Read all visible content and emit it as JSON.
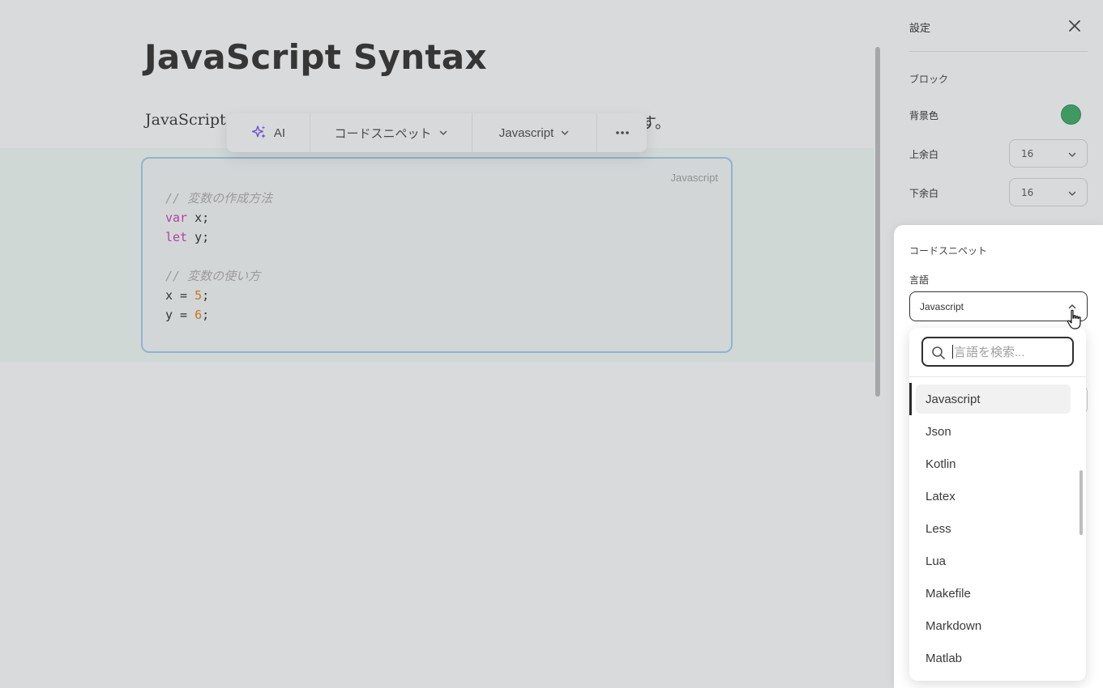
{
  "editor": {
    "title": "JavaScript Syntax",
    "paragraph_head": "JavaScript s",
    "paragraph_tail": "す。",
    "code_block": {
      "language_label": "Javascript",
      "lines": [
        {
          "parts": [
            {
              "t": "// 変数の作成方法",
              "c": "comment"
            }
          ]
        },
        {
          "parts": [
            {
              "t": "var",
              "c": "kw"
            },
            {
              "t": " x;",
              "c": ""
            }
          ]
        },
        {
          "parts": [
            {
              "t": "let",
              "c": "kw"
            },
            {
              "t": " y;",
              "c": ""
            }
          ]
        },
        {
          "parts": [
            {
              "t": "",
              "c": ""
            }
          ]
        },
        {
          "parts": [
            {
              "t": "// 変数の使い方",
              "c": "comment"
            }
          ]
        },
        {
          "parts": [
            {
              "t": "x = ",
              "c": ""
            },
            {
              "t": "5",
              "c": "num"
            },
            {
              "t": ";",
              "c": ""
            }
          ]
        },
        {
          "parts": [
            {
              "t": "y = ",
              "c": ""
            },
            {
              "t": "6",
              "c": "num"
            },
            {
              "t": ";",
              "c": ""
            }
          ]
        }
      ]
    }
  },
  "toolbar": {
    "ai_label": "AI",
    "snippet_label": "コードスニペット",
    "language_label": "Javascript",
    "more_icon": "more-horizontal-icon"
  },
  "panel": {
    "title": "設定",
    "block_section": "ブロック",
    "bg_color_label": "背景色",
    "bg_color": "#3f9a62",
    "top_margin_label": "上余白",
    "top_margin_value": "16",
    "bottom_margin_label": "下余白",
    "bottom_margin_value": "16"
  },
  "snippet": {
    "title": "コードスニペット",
    "language_label": "言語",
    "selected_language": "Javascript",
    "search_placeholder": "言語を検索...",
    "options": [
      "Javascript",
      "Json",
      "Kotlin",
      "Latex",
      "Less",
      "Lua",
      "Makefile",
      "Markdown",
      "Matlab"
    ]
  },
  "colors": {
    "accent_purple": "#6a55c8",
    "code_border": "#8fb4cf"
  }
}
